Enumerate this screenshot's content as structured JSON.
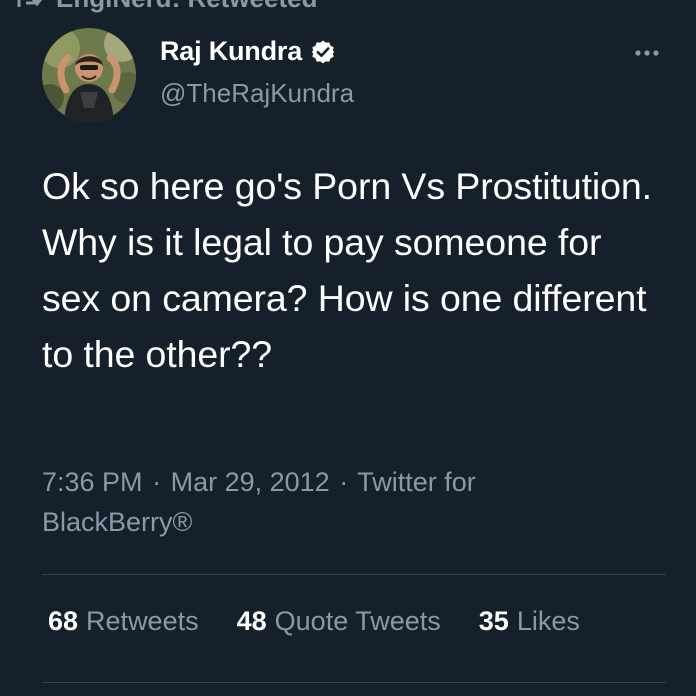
{
  "social_context": {
    "text": "EngiNerd: Retweeted"
  },
  "author": {
    "name": "Raj Kundra",
    "handle": "@TheRajKundra",
    "verified": true
  },
  "tweet": {
    "text": "Ok so here go's Porn Vs Prostitution. Why is it legal to pay someone for sex on camera? How is one different to the other??",
    "time": "7:36 PM",
    "separator": "·",
    "date": "Mar 29, 2012",
    "source": "Twitter for BlackBerry®"
  },
  "stats": {
    "retweets": {
      "count": "68",
      "label": "Retweets"
    },
    "quote_tweets": {
      "count": "48",
      "label": "Quote Tweets"
    },
    "likes": {
      "count": "35",
      "label": "Likes"
    }
  },
  "colors": {
    "background": "#15202b",
    "primary_text": "#ffffff",
    "secondary_text": "#8b98a5",
    "divider": "#38444d",
    "verified_badge": "#ffffff"
  },
  "icons": {
    "retweet": "retweet-icon",
    "verified": "verified-badge-icon",
    "more": "more-options-icon"
  }
}
